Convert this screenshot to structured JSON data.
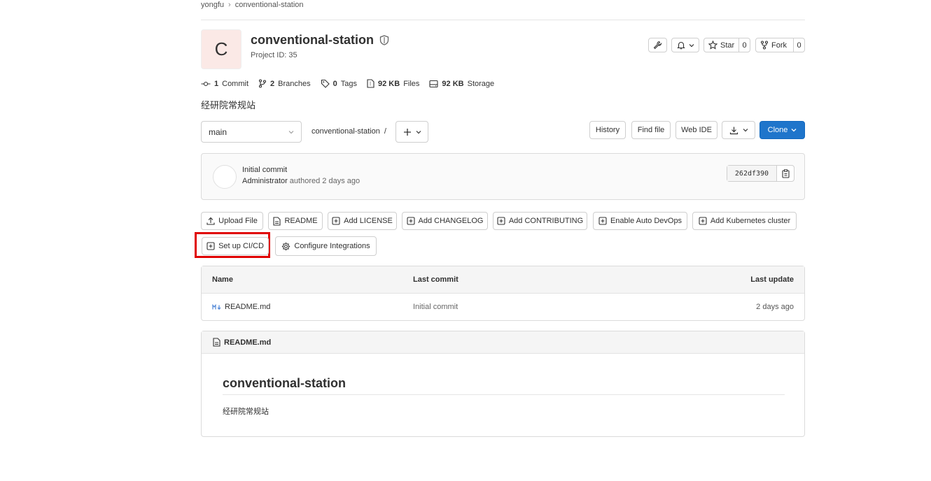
{
  "breadcrumb": {
    "namespace": "yongfu",
    "project": "conventional-station"
  },
  "project": {
    "avatar_letter": "C",
    "name": "conventional-station",
    "id_text": "Project ID: 35",
    "description": "经研院常规站"
  },
  "header_actions": {
    "star_label": "Star",
    "star_count": "0",
    "fork_label": "Fork",
    "fork_count": "0"
  },
  "stats": {
    "commits_num": "1",
    "commits_label": "Commit",
    "branches_num": "2",
    "branches_label": "Branches",
    "tags_num": "0",
    "tags_label": "Tags",
    "files_num": "92 KB",
    "files_label": "Files",
    "storage_num": "92 KB",
    "storage_label": "Storage"
  },
  "repo_nav": {
    "branch": "main",
    "path": "conventional-station",
    "separator": "/",
    "history_label": "History",
    "find_file_label": "Find file",
    "web_ide_label": "Web IDE",
    "clone_label": "Clone"
  },
  "last_commit": {
    "title": "Initial commit",
    "author": "Administrator",
    "meta": "authored 2 days ago",
    "sha": "262df390"
  },
  "quick_actions": {
    "upload_file": "Upload File",
    "readme": "README",
    "add_license": "Add LICENSE",
    "add_changelog": "Add CHANGELOG",
    "add_contributing": "Add CONTRIBUTING",
    "enable_auto_devops": "Enable Auto DevOps",
    "add_kubernetes": "Add Kubernetes cluster",
    "setup_cicd": "Set up CI/CD",
    "configure_integrations": "Configure Integrations"
  },
  "file_table": {
    "headers": {
      "name": "Name",
      "last_commit": "Last commit",
      "last_update": "Last update"
    },
    "rows": [
      {
        "name": "README.md",
        "commit": "Initial commit",
        "updated": "2 days ago"
      }
    ]
  },
  "readme": {
    "filename": "README.md",
    "heading": "conventional-station",
    "body": "经研院常规站"
  },
  "colors": {
    "primary": "#1f75cb",
    "highlight": "#e00000",
    "avatar_bg": "#fbe9e6"
  }
}
